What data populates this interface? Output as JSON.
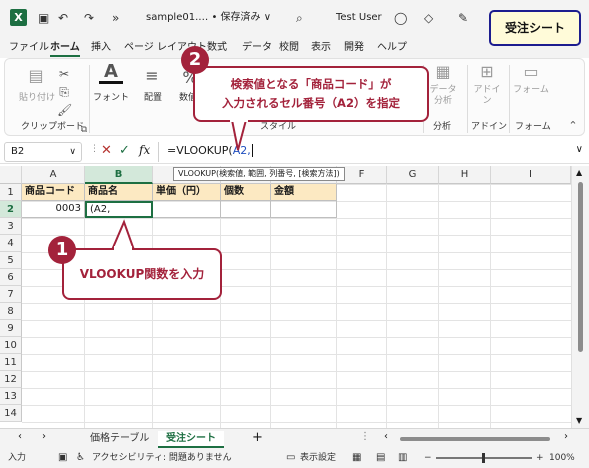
{
  "titlebar": {
    "filename": "sample01.… • 保存済み ∨",
    "user": "Test User",
    "excel_icon": "X",
    "overflow_glyph": "»"
  },
  "menu": {
    "tabs": [
      "ファイル",
      "ホーム",
      "挿入",
      "ページ レイアウト",
      "数式",
      "データ",
      "校閲",
      "表示",
      "開発",
      "ヘルプ"
    ]
  },
  "ribbon": {
    "paste": "貼り付け",
    "clipboard": "クリップボード",
    "font": "フォント",
    "align": "配置",
    "number": "数値",
    "style_group": "スタイル",
    "data_analysis": "データ分析",
    "analysis": "分析",
    "addin": "アドイン",
    "form": "フォーム"
  },
  "formulabar": {
    "namebox": "B2",
    "formula_prefix": "=VLOOKUP(",
    "formula_arg": "A2,",
    "tooltip": "VLOOKUP(検索値, 範囲, 列番号, [検索方法])"
  },
  "grid": {
    "columns": [
      "A",
      "B",
      "C",
      "D",
      "E",
      "F",
      "G",
      "H",
      "I"
    ],
    "rows": [
      "1",
      "2",
      "3",
      "4",
      "5",
      "6",
      "7",
      "8",
      "9",
      "10",
      "11",
      "12",
      "13",
      "14"
    ],
    "header_row": [
      "商品コード",
      "商品名",
      "単価（円）",
      "個数",
      "金額"
    ],
    "a2": "0003",
    "b2": "(A2,"
  },
  "sheets": {
    "tabs": [
      "価格テーブル",
      "受注シート"
    ],
    "add": "+"
  },
  "statusbar": {
    "mode": "入力",
    "accessibility": "アクセシビリティ: 問題ありません",
    "display_settings": "表示設定",
    "zoom": "100%"
  },
  "annotations": {
    "callout1": "VLOOKUP関数を入力",
    "badge1": "1",
    "callout2_line1": "検索値となる「商品コード」が",
    "callout2_line2": "入力されるセル番号（A2）を指定",
    "badge2": "2",
    "sheet_label": "受注シート"
  },
  "colors": {
    "accent": "#1d6f42",
    "callout": "#a3223b",
    "header_fill": "#fce9c2"
  }
}
